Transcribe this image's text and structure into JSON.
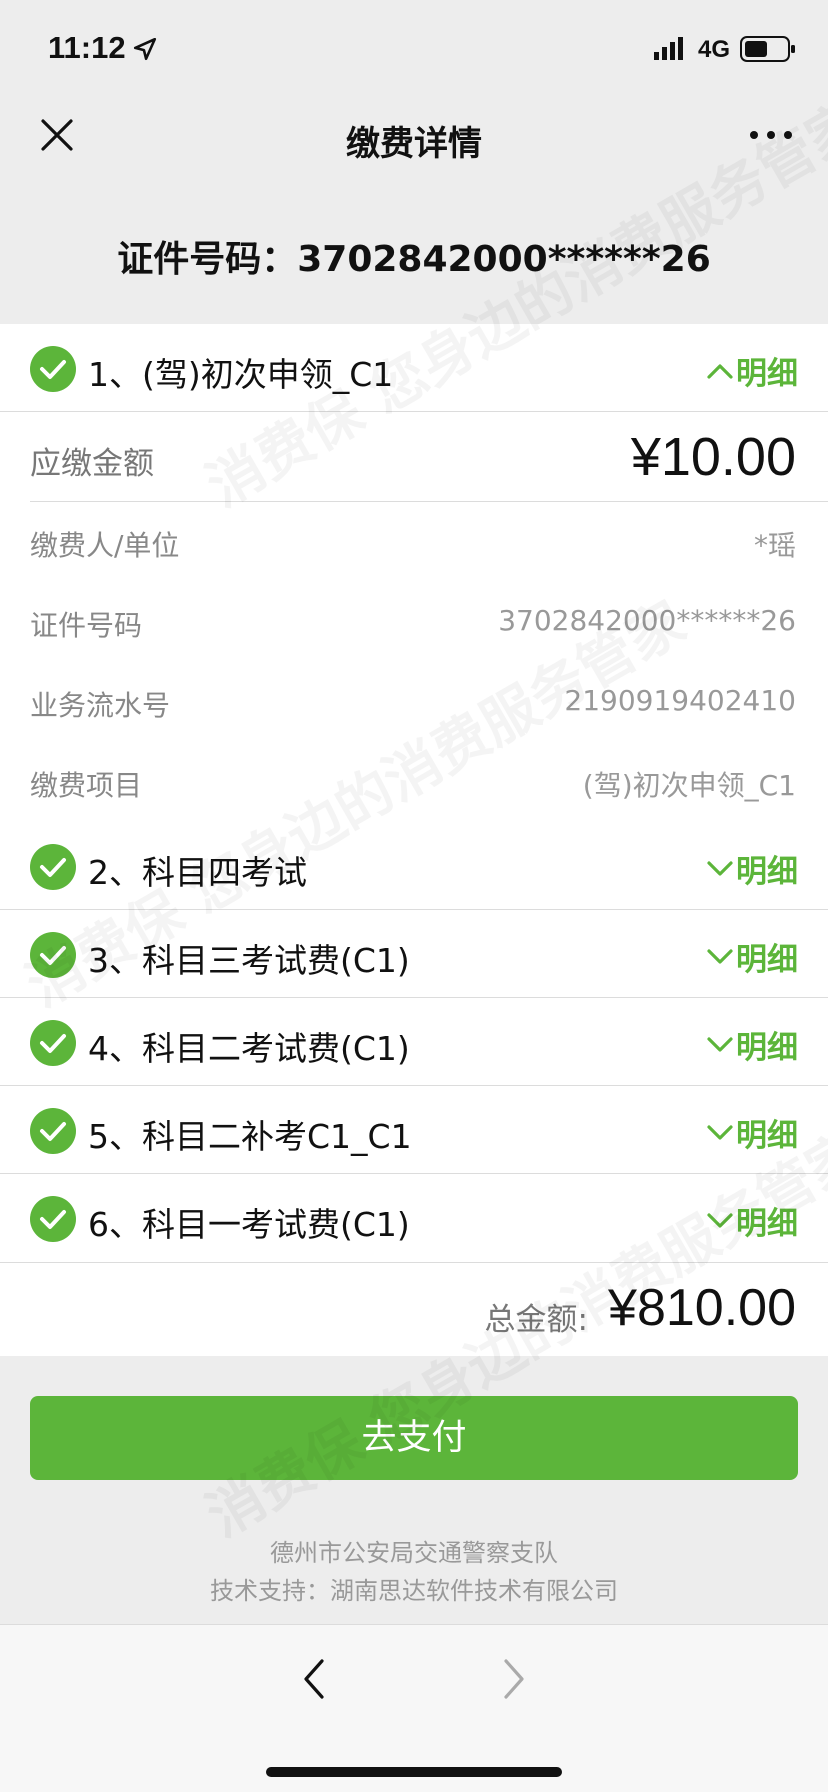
{
  "status": {
    "time": "11:12",
    "network": "4G"
  },
  "nav": {
    "title": "缴费详情"
  },
  "header": {
    "id_label": "证件号码：3702842000******26"
  },
  "items": [
    {
      "index_title": "1、(驾)初次申领_C1",
      "toggle": "明细",
      "expanded": true
    },
    {
      "index_title": "2、科目四考试",
      "toggle": "明细",
      "expanded": false
    },
    {
      "index_title": "3、科目三考试费(C1)",
      "toggle": "明细",
      "expanded": false
    },
    {
      "index_title": "4、科目二考试费(C1)",
      "toggle": "明细",
      "expanded": false
    },
    {
      "index_title": "5、科目二补考C1_C1",
      "toggle": "明细",
      "expanded": false
    },
    {
      "index_title": "6、科目一考试费(C1)",
      "toggle": "明细",
      "expanded": false
    }
  ],
  "detail": {
    "amount_label": "应缴金额",
    "amount_value": "¥10.00",
    "rows": [
      {
        "label": "缴费人/单位",
        "value": "*瑶"
      },
      {
        "label": "证件号码",
        "value": "3702842000******26"
      },
      {
        "label": "业务流水号",
        "value": "2190919402410"
      },
      {
        "label": "缴费项目",
        "value": "(驾)初次申领_C1"
      }
    ]
  },
  "total": {
    "label": "总金额:",
    "value": "¥810.00"
  },
  "pay_button": {
    "label": "去支付"
  },
  "footer": {
    "line1": "德州市公安局交通警察支队",
    "line2": "技术支持：湖南思达软件技术有限公司"
  },
  "watermark": {
    "text": "消费保 您身边的消费服务管家"
  },
  "colors": {
    "accent": "#5cb53a",
    "background": "#ededed"
  },
  "icons": [
    "location-arrow-icon",
    "signal-icon",
    "battery-icon",
    "close-icon",
    "more-icon",
    "check-circle-icon",
    "chevron-up-icon",
    "chevron-down-icon",
    "back-icon",
    "forward-icon"
  ]
}
